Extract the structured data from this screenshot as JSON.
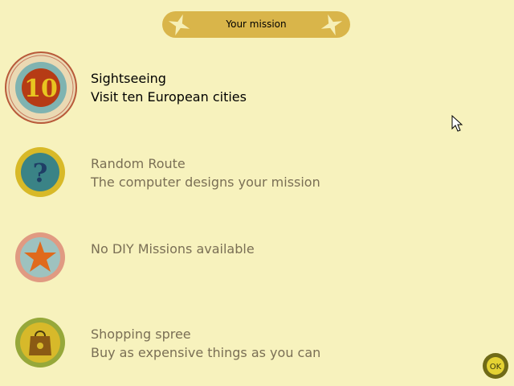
{
  "header": {
    "title": "Your mission"
  },
  "missions": [
    {
      "badge": "10",
      "title": "Sightseeing",
      "description": "Visit ten European cities",
      "selected": true,
      "icon": "number-10-icon"
    },
    {
      "badge": "?",
      "title": "Random Route",
      "description": "The computer designs your mission",
      "selected": false,
      "icon": "question-mark-icon"
    },
    {
      "title": "No DIY Missions available",
      "description": "",
      "selected": false,
      "icon": "star-icon"
    },
    {
      "title": "Shopping spree",
      "description": "Buy as expensive things as you can",
      "selected": false,
      "icon": "shopping-bag-icon"
    }
  ],
  "ok_button": {
    "label": "OK"
  },
  "colors": {
    "background": "#f7f2bd",
    "banner": "#d9b54a",
    "selected_text": "#000000",
    "inactive_text": "#7a6f55"
  }
}
